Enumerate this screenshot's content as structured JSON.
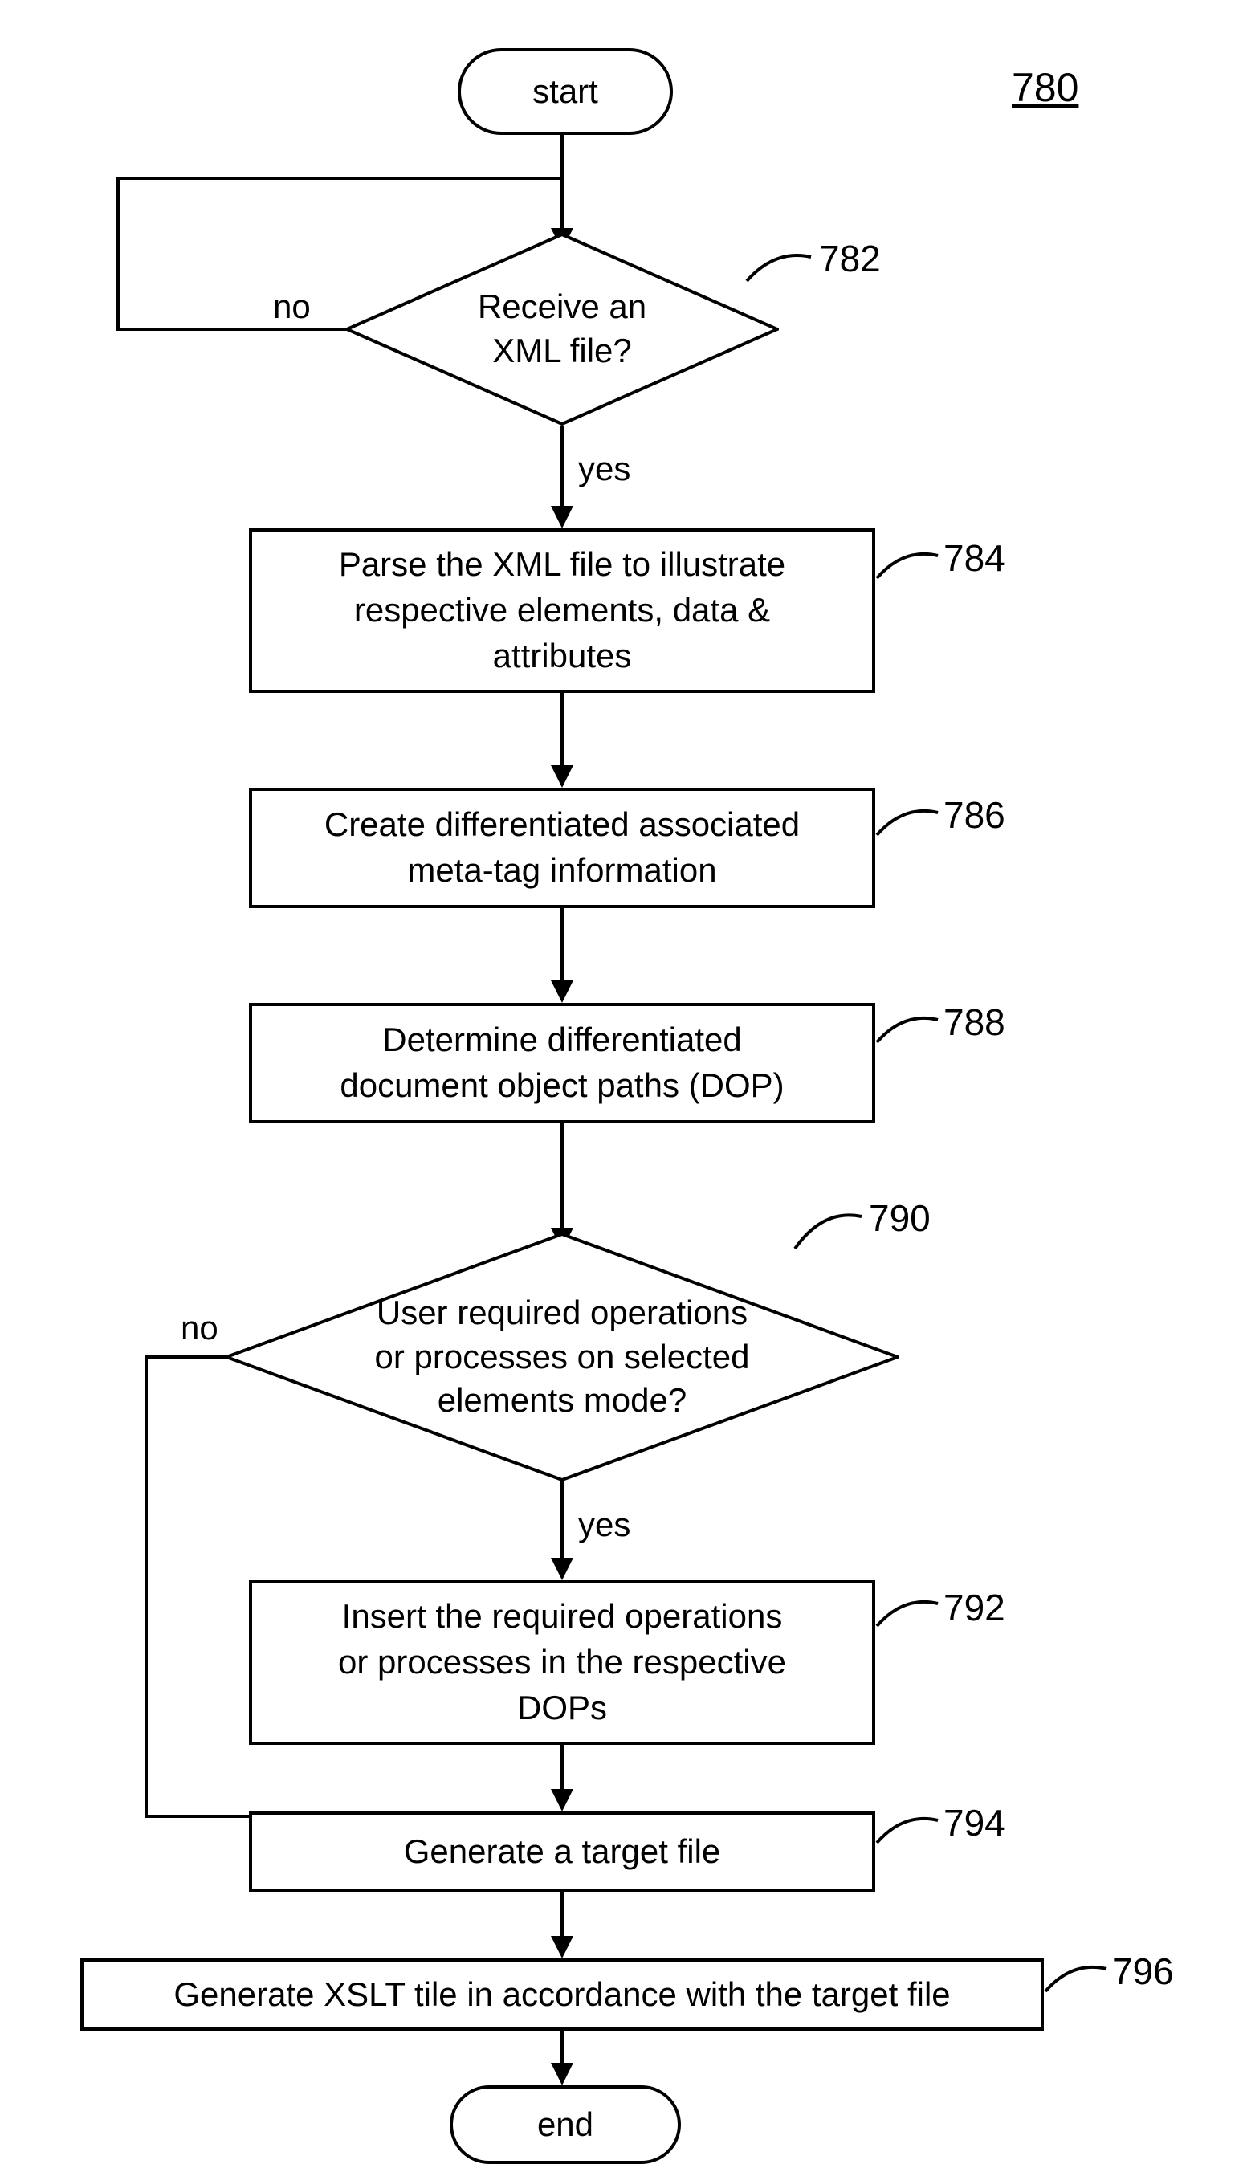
{
  "figure_ref": "780",
  "nodes": {
    "start": "start",
    "end": "end",
    "d1": {
      "text": "Receive an\nXML file?",
      "ref": "782"
    },
    "p1": {
      "text": "Parse the XML file to illustrate\nrespective elements, data &\nattributes",
      "ref": "784"
    },
    "p2": {
      "text": "Create differentiated associated\nmeta-tag information",
      "ref": "786"
    },
    "p3": {
      "text": "Determine differentiated\ndocument object paths (DOP)",
      "ref": "788"
    },
    "d2": {
      "text": "User required operations\nor processes on selected\nelements mode?",
      "ref": "790"
    },
    "p4": {
      "text": "Insert the required operations\nor processes in the respective\nDOPs",
      "ref": "792"
    },
    "p5": {
      "text": "Generate a target file",
      "ref": "794"
    },
    "p6": {
      "text": "Generate XSLT tile in accordance with the target file",
      "ref": "796"
    }
  },
  "edge_labels": {
    "d1_no": "no",
    "d1_yes": "yes",
    "d2_no": "no",
    "d2_yes": "yes"
  }
}
